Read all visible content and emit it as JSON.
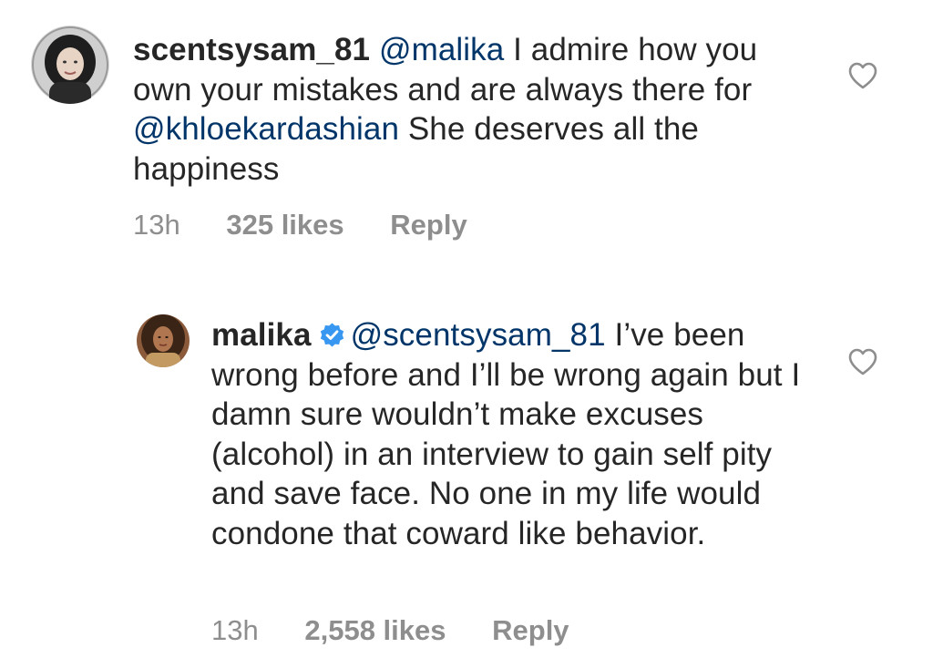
{
  "comments": [
    {
      "username": "scentsysam_81",
      "verified": false,
      "mention": "@malika",
      "text_before": " I admire how you own your mistakes and are always there for ",
      "mention2": "@khloekardashian",
      "text_after": " She deserves all the happiness",
      "time": "13h",
      "likes": "325 likes",
      "reply_label": "Reply",
      "avatar_icon": "avatar-woman-dark-hair",
      "heart_icon": "heart-outline-icon"
    },
    {
      "username": "malika",
      "verified": true,
      "verified_color": "#3897f0",
      "mention": "@scentsysam_81",
      "text": " I’ve been wrong before and I’ll be wrong again but I damn sure wouldn’t make excuses (alcohol) in an interview to gain self pity and save face. No one in my life would condone that coward like behavior.",
      "time": "13h",
      "likes": "2,558 likes",
      "reply_label": "Reply",
      "avatar_icon": "avatar-woman-brown-tones",
      "heart_icon": "heart-outline-icon"
    }
  ],
  "colors": {
    "text": "#262626",
    "mention": "#003569",
    "meta": "#8e8e8e",
    "heart": "#8e8e8e"
  }
}
